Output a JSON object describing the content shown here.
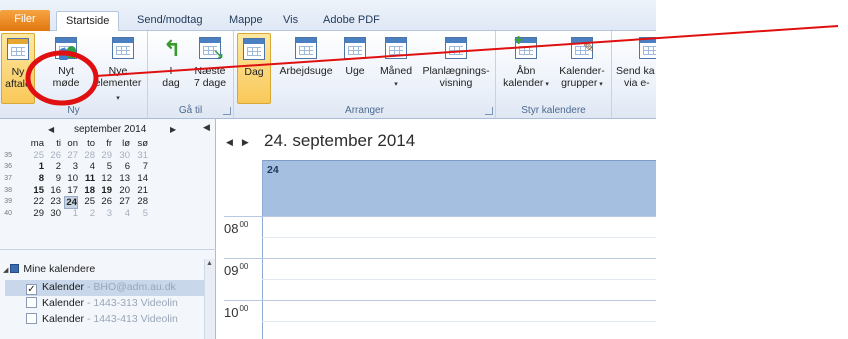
{
  "tabs": [
    {
      "label": "Filer"
    },
    {
      "label": "Startside"
    },
    {
      "label": "Send/modtag"
    },
    {
      "label": "Mappe"
    },
    {
      "label": "Vis"
    },
    {
      "label": "Adobe PDF"
    }
  ],
  "ribbon": {
    "groups": {
      "new": "Ny",
      "goto": "Gå til",
      "arrange": "Arranger",
      "manage": "Styr kalendere"
    },
    "buttons": {
      "new_appointment": [
        "Ny",
        "aftale"
      ],
      "new_meeting": [
        "Nyt",
        "møde"
      ],
      "new_items": [
        "Nye",
        "elementer"
      ],
      "today": [
        "I",
        "dag"
      ],
      "next7": [
        "Næste",
        "7 dage"
      ],
      "day": [
        "Dag",
        ""
      ],
      "workweek": [
        "Arbejdsuge",
        ""
      ],
      "week": [
        "Uge",
        ""
      ],
      "month": [
        "Måned",
        ""
      ],
      "schedule": [
        "Planlægnings-",
        "visning"
      ],
      "open_calendar": [
        "Åbn",
        "kalender"
      ],
      "calendar_groups": [
        "Kalender-",
        "grupper"
      ],
      "send_calendar": [
        "Send ka",
        "via e-"
      ]
    }
  },
  "mini_calendar": {
    "title": "september 2014",
    "weekday_headers": [
      "ma",
      "ti",
      "on",
      "to",
      "fr",
      "lø",
      "sø"
    ],
    "weeks": [
      {
        "wk": "35",
        "days": [
          [
            "25",
            "dim"
          ],
          [
            "26",
            "dim"
          ],
          [
            "27",
            "dim"
          ],
          [
            "28",
            "dim"
          ],
          [
            "29",
            "dim"
          ],
          [
            "30",
            "dim"
          ],
          [
            "31",
            "dim"
          ]
        ]
      },
      {
        "wk": "36",
        "days": [
          [
            "1",
            "bold"
          ],
          [
            "2",
            ""
          ],
          [
            "3",
            ""
          ],
          [
            "4",
            ""
          ],
          [
            "5",
            ""
          ],
          [
            "6",
            ""
          ],
          [
            "7",
            ""
          ]
        ]
      },
      {
        "wk": "37",
        "days": [
          [
            "8",
            "bold"
          ],
          [
            "9",
            ""
          ],
          [
            "10",
            ""
          ],
          [
            "11",
            "bold"
          ],
          [
            "12",
            ""
          ],
          [
            "13",
            ""
          ],
          [
            "14",
            ""
          ]
        ]
      },
      {
        "wk": "38",
        "days": [
          [
            "15",
            "bold"
          ],
          [
            "16",
            ""
          ],
          [
            "17",
            ""
          ],
          [
            "18",
            "bold"
          ],
          [
            "19",
            "bold"
          ],
          [
            "20",
            ""
          ],
          [
            "21",
            ""
          ]
        ]
      },
      {
        "wk": "39",
        "days": [
          [
            "22",
            ""
          ],
          [
            "23",
            ""
          ],
          [
            "24",
            "today"
          ],
          [
            "25",
            ""
          ],
          [
            "26",
            ""
          ],
          [
            "27",
            ""
          ],
          [
            "28",
            ""
          ]
        ]
      },
      {
        "wk": "40",
        "days": [
          [
            "29",
            ""
          ],
          [
            "30",
            ""
          ],
          [
            "1",
            "dim"
          ],
          [
            "2",
            "dim"
          ],
          [
            "3",
            "dim"
          ],
          [
            "4",
            "dim"
          ],
          [
            "5",
            "dim"
          ]
        ]
      }
    ]
  },
  "my_calendars": {
    "heading": "Mine kalendere",
    "items": [
      {
        "name": "Kalender",
        "sub": " - BHO@adm.au.dk",
        "checked": "✓"
      },
      {
        "name": "Kalender",
        "sub": " - 1443-313 Videolin",
        "checked": ""
      },
      {
        "name": "Kalender",
        "sub": " - 1443-413 Videolin",
        "checked": ""
      }
    ]
  },
  "day_view": {
    "date_title": "24. september 2014",
    "day_number": "24",
    "times": [
      {
        "h": "08",
        "m": "00"
      },
      {
        "h": "09",
        "m": "00"
      },
      {
        "h": "10",
        "m": "00"
      }
    ]
  },
  "colors": {
    "ribbon_tab_file": "#e2770f",
    "selected_button": "#f9c859",
    "day_header": "#a5bfe1",
    "annotation": "#e01010"
  }
}
